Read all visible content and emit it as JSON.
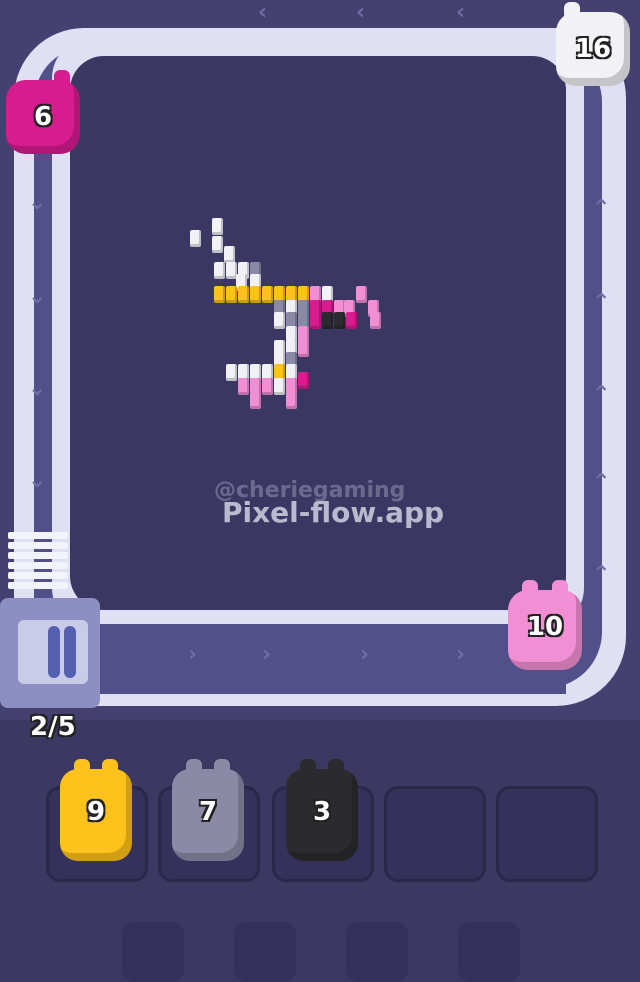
{
  "level_counter": "2/5",
  "watermark": {
    "handle": "@cheriegaming",
    "site": "Pixel-flow.app"
  },
  "colors": {
    "white": "#f1f1f6",
    "pink": "#f28fd4",
    "magenta": "#d61c8f",
    "yellow": "#ffc21c",
    "gray": "#8b8aa6",
    "black": "#2b2b2f"
  },
  "track_pigs": [
    {
      "label": "6",
      "color": "#d61c8f",
      "name": "magenta-pig"
    },
    {
      "label": "16",
      "color": "#f1f1f6",
      "name": "white-pig"
    },
    {
      "label": "10",
      "color": "#f28fd4",
      "name": "pink-pig"
    }
  ],
  "queue": [
    {
      "label": "9",
      "color": "#ffc21c",
      "name": "yellow"
    },
    {
      "label": "7",
      "color": "#8b8aa6",
      "name": "gray"
    },
    {
      "label": "3",
      "color": "#2b2b2f",
      "name": "black"
    },
    {
      "label": "",
      "color": "",
      "name": "empty"
    },
    {
      "label": "",
      "color": "",
      "name": "empty"
    }
  ]
}
